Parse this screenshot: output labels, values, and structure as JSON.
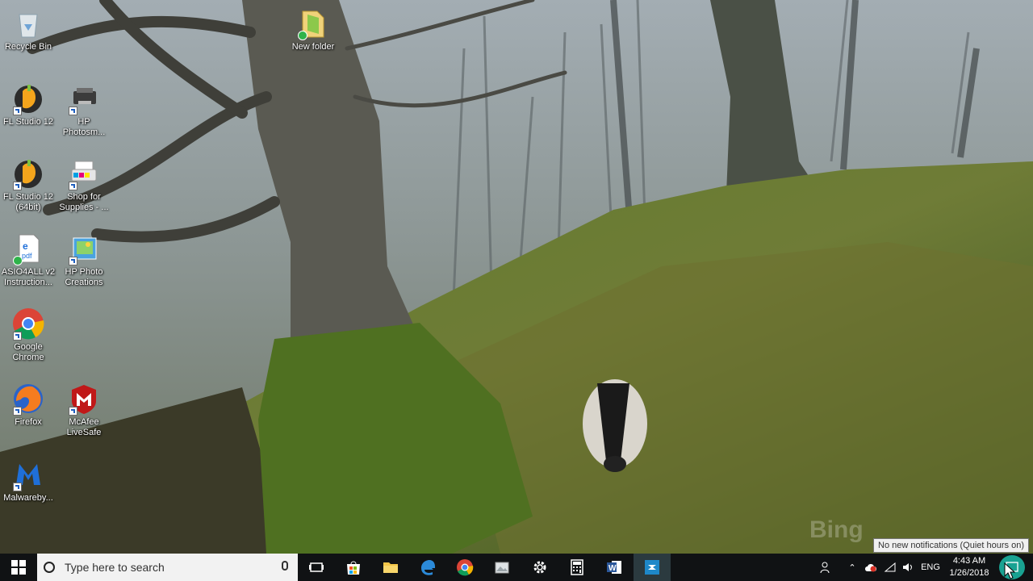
{
  "desktop": {
    "icons": [
      {
        "label": "Recycle Bin",
        "icon": "recycle-bin-icon"
      },
      {
        "label": "New folder",
        "icon": "folder-icon"
      },
      {
        "label": "FL Studio 12",
        "icon": "fl-studio-icon"
      },
      {
        "label": "HP\nPhotosm...",
        "icon": "hp-photosmart-icon"
      },
      {
        "label": "FL Studio 12\n(64bit)",
        "icon": "fl-studio-64-icon"
      },
      {
        "label": "Shop for\nSupplies - ...",
        "icon": "printer-supplies-icon"
      },
      {
        "label": "ASIO4ALL v2\nInstruction...",
        "icon": "pdf-file-icon"
      },
      {
        "label": "HP Photo\nCreations",
        "icon": "hp-photo-creations-icon"
      },
      {
        "label": "Google\nChrome",
        "icon": "chrome-icon"
      },
      {
        "label": "Firefox",
        "icon": "firefox-icon"
      },
      {
        "label": "McAfee\nLiveSafe",
        "icon": "mcafee-icon"
      },
      {
        "label": "Malwareby...",
        "icon": "malwarebytes-icon"
      }
    ],
    "watermark": "Bing"
  },
  "taskbar": {
    "search_placeholder": "Type here to search",
    "apps": [
      "task-view-icon",
      "store-icon",
      "file-explorer-icon",
      "edge-icon",
      "chrome-icon",
      "photos-icon",
      "settings-icon",
      "calculator-icon",
      "word-icon",
      "app-icon"
    ],
    "tray": {
      "language": "ENG",
      "time": "4:43 AM",
      "date": "1/26/2018"
    },
    "tooltip": "No new notifications (Quiet hours on)"
  },
  "colors": {
    "taskbar_bg": "#101214",
    "search_bg": "#f2f2f2",
    "highlight": "#1bb3a0"
  }
}
